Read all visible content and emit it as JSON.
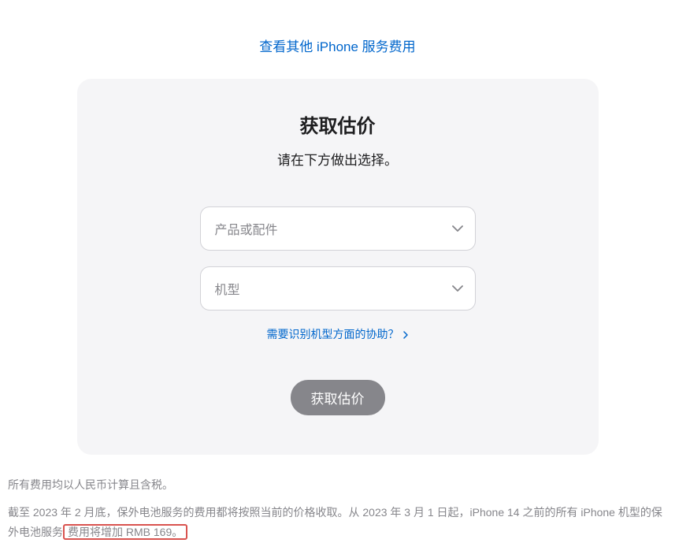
{
  "topLink": {
    "label": "查看其他 iPhone 服务费用"
  },
  "card": {
    "title": "获取估价",
    "subtitle": "请在下方做出选择。",
    "select1": {
      "placeholder": "产品或配件"
    },
    "select2": {
      "placeholder": "机型"
    },
    "helpLink": {
      "label": "需要识别机型方面的协助？"
    },
    "submit": {
      "label": "获取估价"
    }
  },
  "footer": {
    "line1": "所有费用均以人民币计算且含税。",
    "line2_part1": "截至 2023 年 2 月底，保外电池服务的费用都将按照当前的价格收取。从 2023 年 3 月 1 日起，iPhone 14 之前的所有 iPhone 机型的保外电池服务",
    "line2_highlight": "费用将增加 RMB 169。"
  }
}
